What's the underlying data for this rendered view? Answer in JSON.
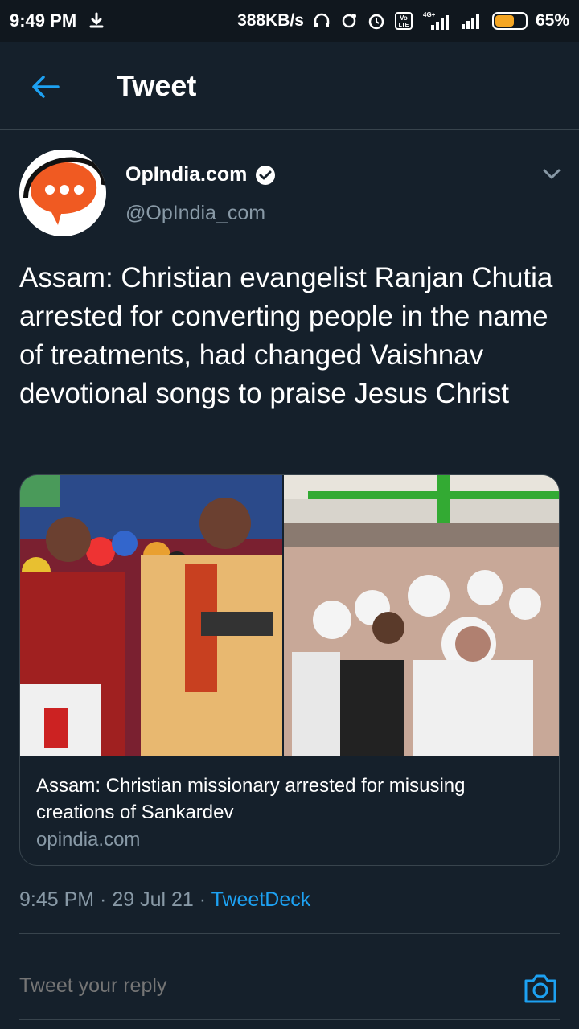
{
  "status_bar": {
    "time": "9:49 PM",
    "network_speed": "388KB/s",
    "network_type": "4G+",
    "volte": "Vo LTE",
    "battery": "65%",
    "battery_level": 0.65
  },
  "header": {
    "title": "Tweet"
  },
  "tweet": {
    "author_name": "OpIndia.com",
    "author_handle": "@OpIndia_com",
    "text": "Assam: Christian evangelist Ranjan Chutia arrested for converting people in the name of treatments, had changed Vaishnav devotional songs to praise Jesus Christ",
    "timestamp": "9:45 PM · 29 Jul 21 · ",
    "source": "TweetDeck"
  },
  "card": {
    "title": "Assam: Christian missionary arrested for misusing creations of Sankardev",
    "domain": "opindia.com"
  },
  "reply": {
    "placeholder": "Tweet your reply"
  },
  "colors": {
    "background": "#15202b",
    "accent": "#1da1f2",
    "secondary_text": "#8899a6",
    "brand_orange": "#f05a22"
  }
}
